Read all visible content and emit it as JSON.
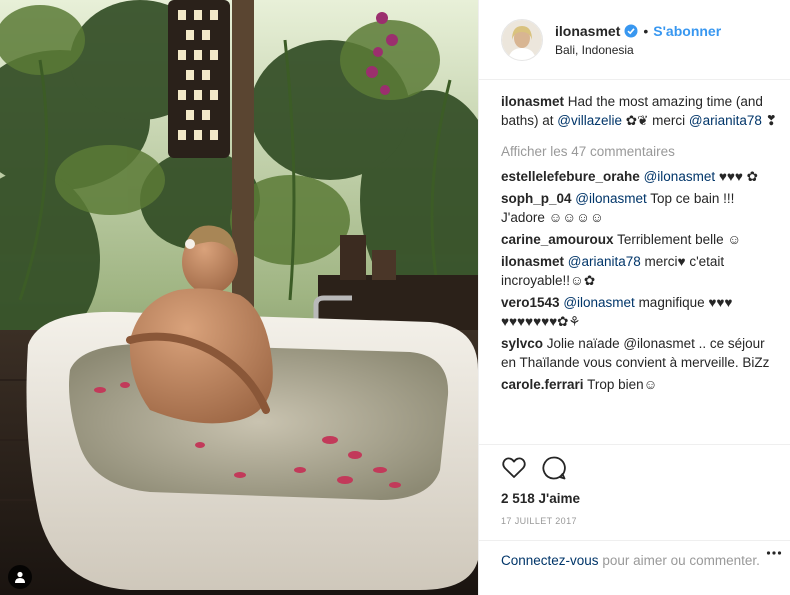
{
  "header": {
    "username": "ilonasmet",
    "follow_label": "S'abonner",
    "separator": "•",
    "location": "Bali, Indonesia"
  },
  "caption": {
    "username": "ilonasmet",
    "text1": "Had the most amazing time (and baths) at ",
    "mention1": "@villazelie",
    "text2": " ✿❦ merci ",
    "mention2": "@arianita78",
    "text3": " ❣"
  },
  "view_comments_label": "Afficher les 47 commentaires",
  "comments": [
    {
      "user": "estellelefebure_orahe",
      "mention": "@ilonasmet",
      "text": " ♥♥♥ ✿"
    },
    {
      "user": "soph_p_04",
      "mention": "@ilonasmet",
      "text": " Top ce bain !!! J'adore ☺☺☺☺"
    },
    {
      "user": "carine_amouroux",
      "mention": "",
      "text": "Terriblement belle ☺"
    },
    {
      "user": "ilonasmet",
      "mention": "@arianita78",
      "text": " merci♥ c'etait incroyable!!☺✿"
    },
    {
      "user": "vero1543",
      "mention": "@ilonasmet",
      "text": " magnifique ♥♥♥ ♥♥♥♥♥♥♥✿⚘"
    },
    {
      "user": "sylvco",
      "mention": "",
      "text": "Jolie naïade @ilonasmet .. ce séjour en Thaïlande vous convient à merveille. BiZz"
    },
    {
      "user": "carole.ferrari",
      "mention": "",
      "text": "Trop bien☺"
    }
  ],
  "likes_label": "2 518 J'aime",
  "date_label": "17 JUILLET 2017",
  "login": {
    "link": "Connectez-vous",
    "text": " pour aimer ou commenter."
  },
  "icons": {
    "verified": "verified-badge-icon",
    "like": "heart-icon",
    "comment": "comment-bubble-icon",
    "more": "more-options-icon",
    "user_tag": "person-tag-icon"
  },
  "colors": {
    "accent": "#3897f0",
    "mention": "#003569",
    "muted": "#999999"
  }
}
